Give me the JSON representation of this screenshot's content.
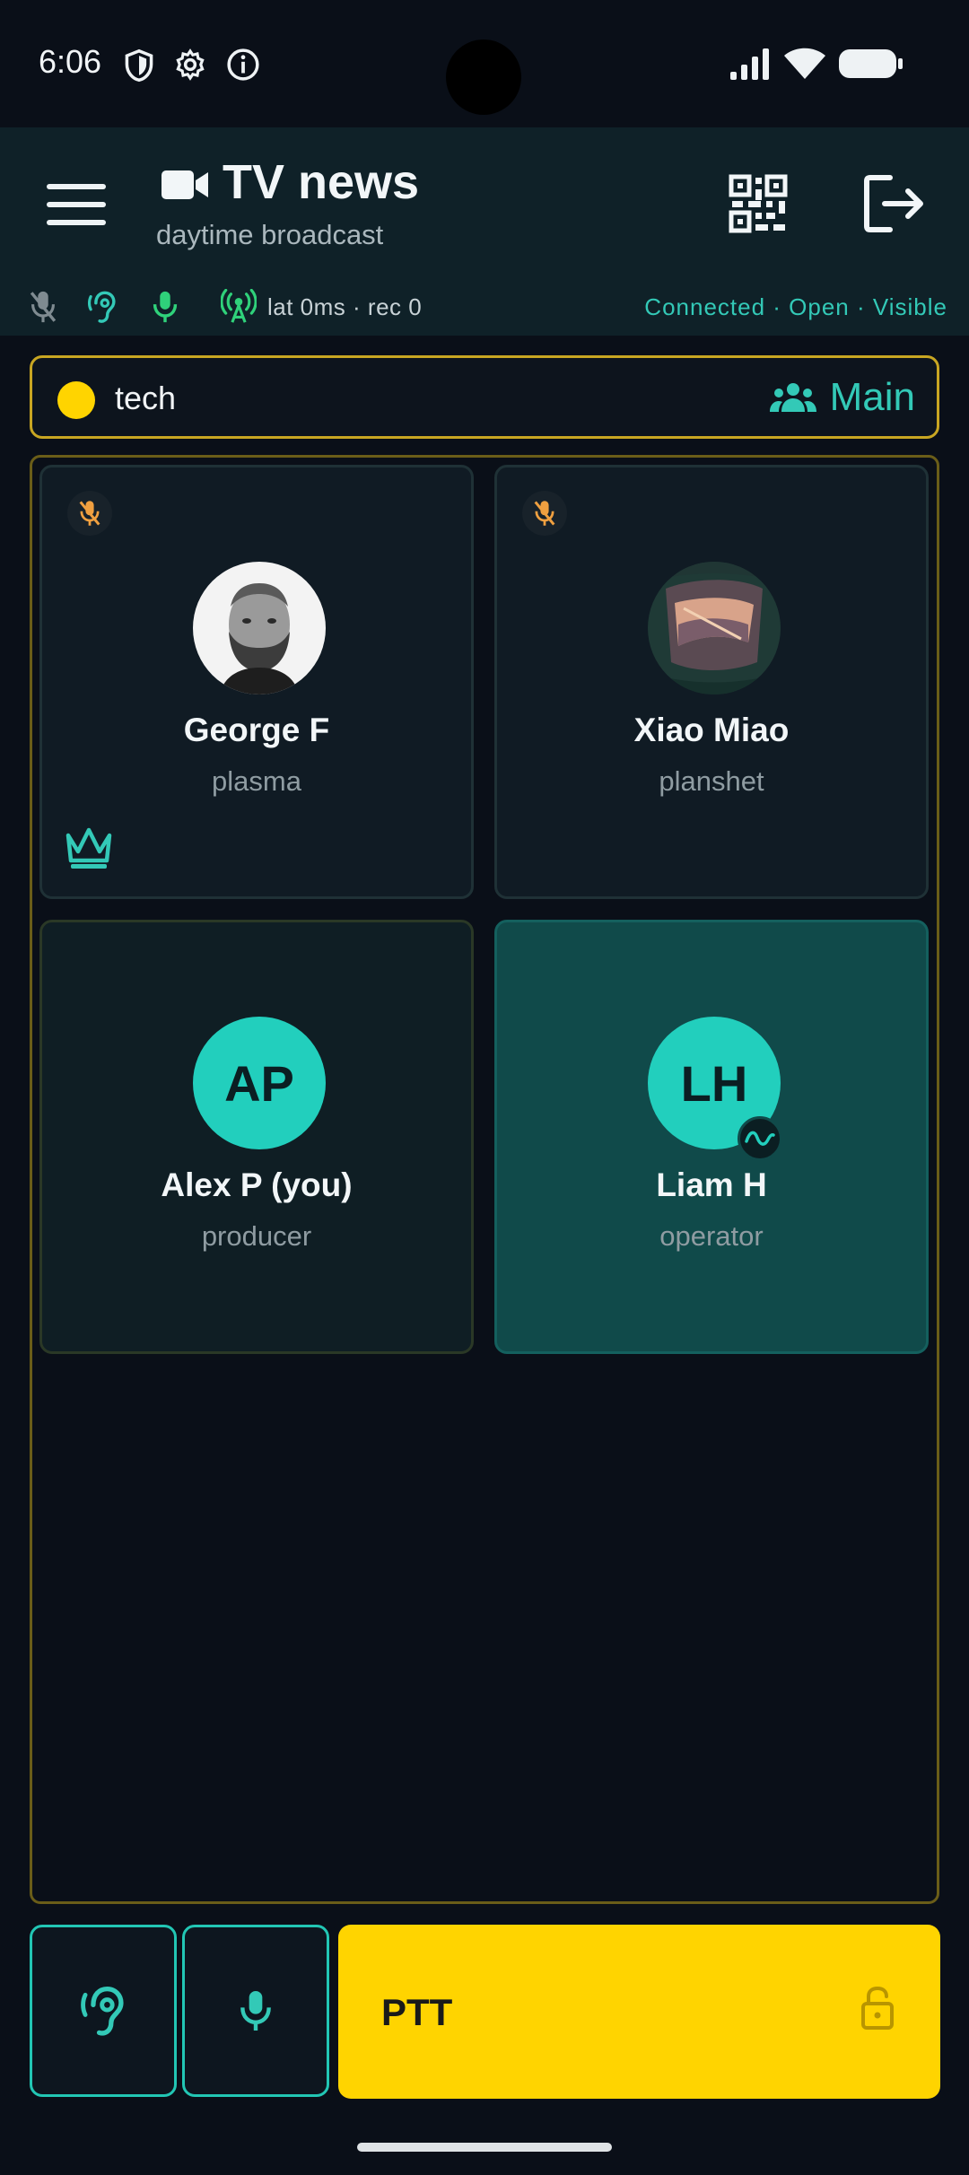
{
  "status_bar": {
    "time": "6:06",
    "icons": [
      "shield-icon",
      "gear-icon",
      "info-icon",
      "signal-icon",
      "wifi-icon",
      "battery-icon"
    ]
  },
  "header": {
    "title": "TV news",
    "subtitle": "daytime broadcast",
    "icons": [
      "menu-icon",
      "video-icon",
      "qr-code-icon",
      "exit-icon"
    ]
  },
  "status_row": {
    "icons": [
      "mic-off-icon",
      "hearing-icon",
      "mic-icon",
      "broadcast-icon"
    ],
    "latency": "lat 0ms · rec 0",
    "connection": "Connected · Open · Visible"
  },
  "channel": {
    "name": "tech",
    "color": "#ffd400",
    "group_label": "Main",
    "group_icon": "group-icon"
  },
  "participants": [
    {
      "name": "George F",
      "role": "plasma",
      "muted": true,
      "avatar": "photo",
      "crown": true
    },
    {
      "name": "Xiao Miao",
      "role": "planshet",
      "muted": true,
      "avatar": "photo"
    },
    {
      "name": "Alex P (you)",
      "role": "producer",
      "avatar_initials": "AP"
    },
    {
      "name": "Liam H",
      "role": "operator",
      "avatar_initials": "LH",
      "speaking": true
    }
  ],
  "controls": {
    "listen_icon": "hearing-icon",
    "mic_icon": "mic-icon",
    "ptt_label": "PTT",
    "lock_icon": "lock-open-icon"
  },
  "colors": {
    "accent": "#33c9b7",
    "ptt": "#ffd400",
    "muted_badge": "#f0a040"
  }
}
